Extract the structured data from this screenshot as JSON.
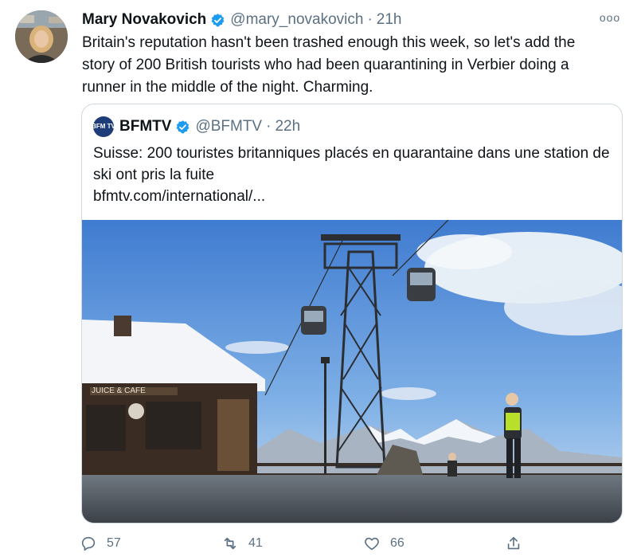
{
  "tweet": {
    "author_name": "Mary Novakovich",
    "handle": "@mary_novakovich",
    "separator": "·",
    "time": "21h",
    "more_label": "ooo",
    "text": "Britain's reputation hasn't been trashed enough this week, so let's add the story of 200 British tourists who had been quarantining in Verbier doing a runner in the middle of the night. Charming."
  },
  "quote": {
    "logo_text": "BFM TV",
    "author_name": "BFMTV",
    "handle": "@BFMTV",
    "separator": "·",
    "time": "22h",
    "text_line1": "Suisse: 200 touristes britanniques placés en quarantaine dans une station de ski ont pris la fuite",
    "link": "bfmtv.com/international/...",
    "image_sign": "JUICE & CAFE"
  },
  "actions": {
    "reply_count": "57",
    "retweet_count": "41",
    "like_count": "66"
  },
  "colors": {
    "verified": "#1d9bf0",
    "secondary_text": "#5b7083",
    "border": "#cfd9de"
  }
}
